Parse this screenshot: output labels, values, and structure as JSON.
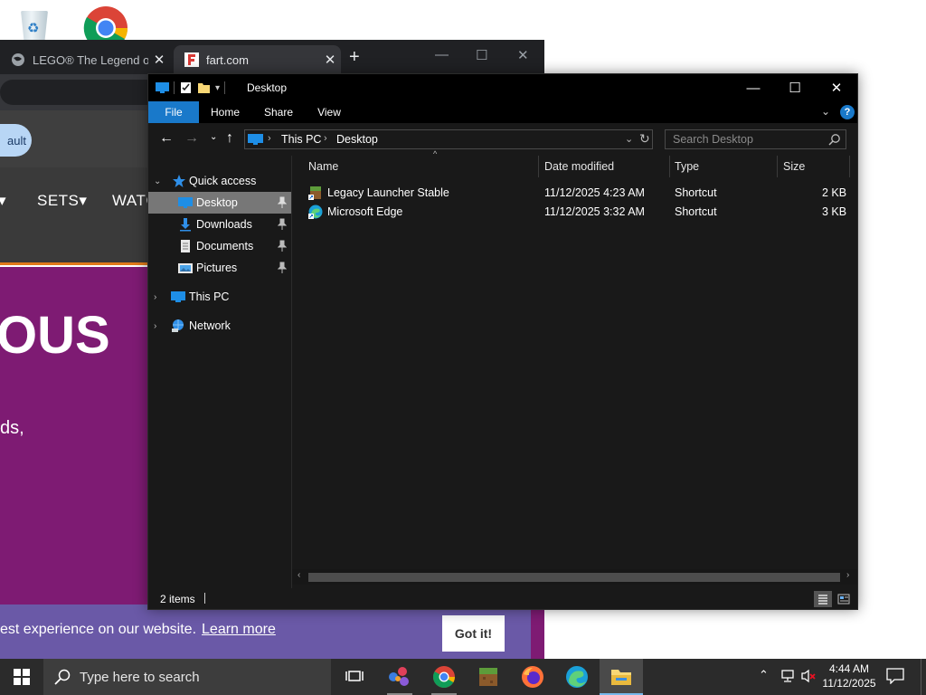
{
  "browser": {
    "tabs": [
      {
        "title": "LEGO® The Legend o"
      },
      {
        "title": "fart.com"
      }
    ],
    "new_tab": "+",
    "default_button": "ault",
    "nav": [
      "SETS▾",
      "WATC"
    ],
    "nav_partial": "▾",
    "hero_text": "OUS",
    "hero_sub": "ds,",
    "cookie": {
      "text": "est experience on our website.",
      "link": "Learn more",
      "button": "Got it!"
    }
  },
  "explorer": {
    "title": "Desktop",
    "ribbon_tabs": [
      "File",
      "Home",
      "Share",
      "View"
    ],
    "help": "?",
    "address": {
      "crumbs": [
        "This PC",
        "Desktop"
      ]
    },
    "search_placeholder": "Search Desktop",
    "nav": {
      "quick_access": "Quick access",
      "pinned": [
        "Desktop",
        "Downloads",
        "Documents",
        "Pictures"
      ],
      "this_pc": "This PC",
      "network": "Network"
    },
    "columns": [
      "Name",
      "Date modified",
      "Type",
      "Size"
    ],
    "files": [
      {
        "name": "Legacy Launcher Stable",
        "date": "11/12/2025 4:23 AM",
        "type": "Shortcut",
        "size": "2 KB"
      },
      {
        "name": "Microsoft Edge",
        "date": "11/12/2025 3:32 AM",
        "type": "Shortcut",
        "size": "3 KB"
      }
    ],
    "status": "2 items"
  },
  "taskbar": {
    "search_placeholder": "Type here to search",
    "time": "4:44 AM",
    "date": "11/12/2025"
  },
  "colors": {
    "explorer_bg": "#191919",
    "accent_blue": "#1979ca",
    "selection": "#777777",
    "taskbar": "#2b2b2b",
    "page_purple": "#7e1b73",
    "cookie_bar": "#6a59a7"
  }
}
